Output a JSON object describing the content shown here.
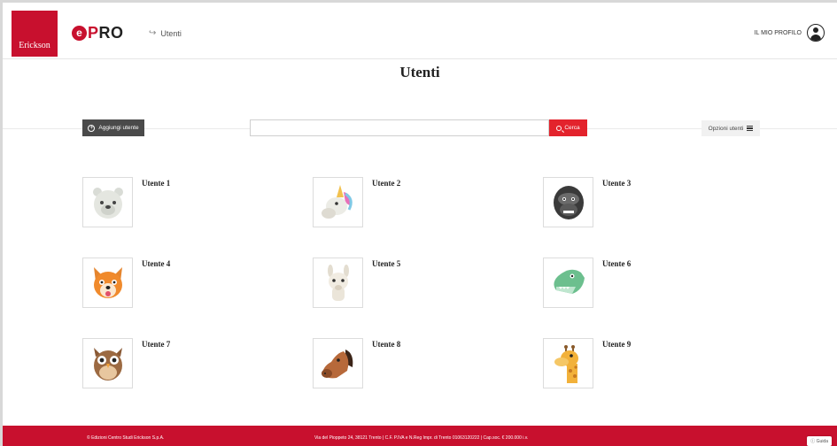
{
  "header": {
    "brand_name": "Erickson",
    "logo": {
      "e": "e",
      "pro_p": "P",
      "pro_rest": "RO"
    },
    "breadcrumb": "Utenti",
    "profile_label": "IL MIO PROFILO"
  },
  "page": {
    "title": "Utenti"
  },
  "toolbar": {
    "add_user_label": "Aggiungi utente",
    "search_value": "",
    "search_placeholder": "",
    "search_button_label": "Cerca",
    "options_label": "Opzioni utenti"
  },
  "users": [
    {
      "name": "Utente 1",
      "avatar": "polar-bear"
    },
    {
      "name": "Utente 2",
      "avatar": "unicorn"
    },
    {
      "name": "Utente 3",
      "avatar": "gorilla"
    },
    {
      "name": "Utente 4",
      "avatar": "fox"
    },
    {
      "name": "Utente 5",
      "avatar": "llama"
    },
    {
      "name": "Utente 6",
      "avatar": "dinosaur"
    },
    {
      "name": "Utente 7",
      "avatar": "owl"
    },
    {
      "name": "Utente 8",
      "avatar": "horse"
    },
    {
      "name": "Utente 9",
      "avatar": "giraffe"
    }
  ],
  "footer": {
    "copyright": "© Edizioni Centro Studi Erickson S.p.A.",
    "address": "Via del Pioppeto 24, 38121 Trento | C.F. P.IVA e N.Reg Impr. di Trento 01063120222 | Cap.soc. € 200.000 i.v.",
    "help_label": "Guida"
  },
  "colors": {
    "brand_red": "#c8102e",
    "search_red": "#e3232c",
    "dark_button": "#4a4a4a"
  }
}
